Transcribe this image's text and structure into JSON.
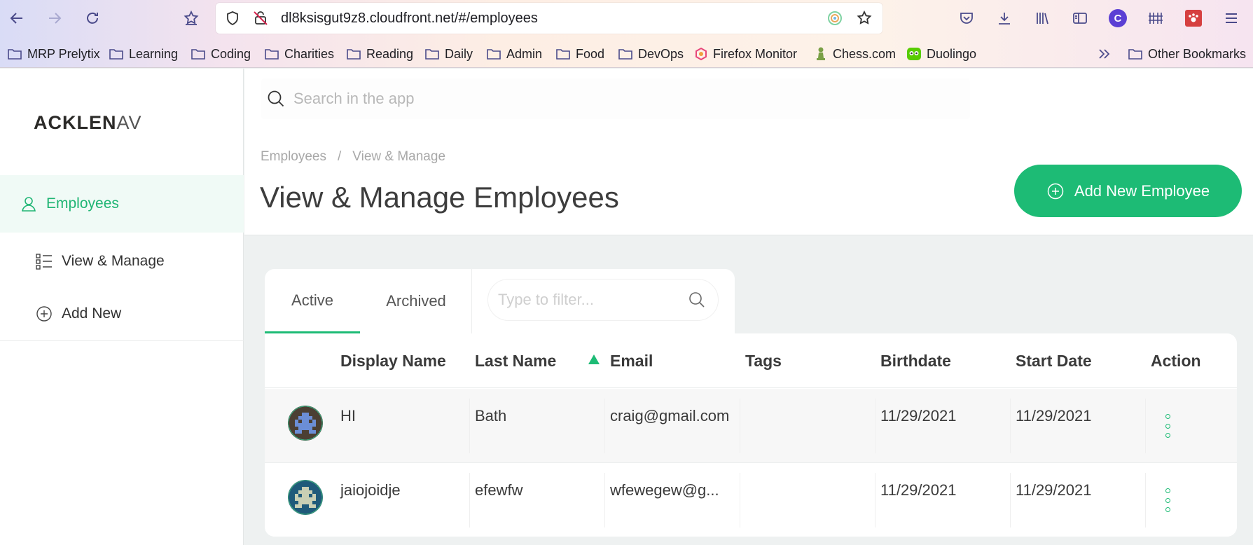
{
  "browser": {
    "url": "dl8ksisgut9z8.cloudfront.net/#/employees",
    "bookmarks": [
      "MRP Prelytix",
      "Learning",
      "Coding",
      "Charities",
      "Reading",
      "Daily",
      "Admin",
      "Food",
      "DevOps",
      "Firefox Monitor",
      "Chess.com",
      "Duolingo"
    ],
    "other_bookmarks": "Other Bookmarks",
    "profile_initial": "C"
  },
  "app": {
    "logo_bold": "ACKLEN",
    "logo_rest": "AV",
    "search_placeholder": "Search in the app",
    "nav": {
      "section": "Employees",
      "items": [
        "View & Manage",
        "Add New"
      ]
    },
    "breadcrumb": [
      "Employees",
      "/",
      "View & Manage"
    ],
    "page_title": "View & Manage Employees",
    "add_button": "Add New Employee",
    "tabs": [
      "Active",
      "Archived"
    ],
    "filter_placeholder": "Type to filter...",
    "columns": [
      "Display Name",
      "Last Name",
      "Email",
      "Tags",
      "Birthdate",
      "Start Date",
      "Action"
    ],
    "rows": [
      {
        "display_name": "HI",
        "last_name": "Bath",
        "email": "craig@gmail.com",
        "tags": "",
        "birthdate": "11/29/2021",
        "start_date": "11/29/2021"
      },
      {
        "display_name": "jaiojoidje",
        "last_name": "efewfw",
        "email": "wfewegew@g...",
        "tags": "",
        "birthdate": "11/29/2021",
        "start_date": "11/29/2021"
      }
    ],
    "colors": {
      "accent": "#1dbb75",
      "accent_bg": "#f0faf6"
    }
  }
}
